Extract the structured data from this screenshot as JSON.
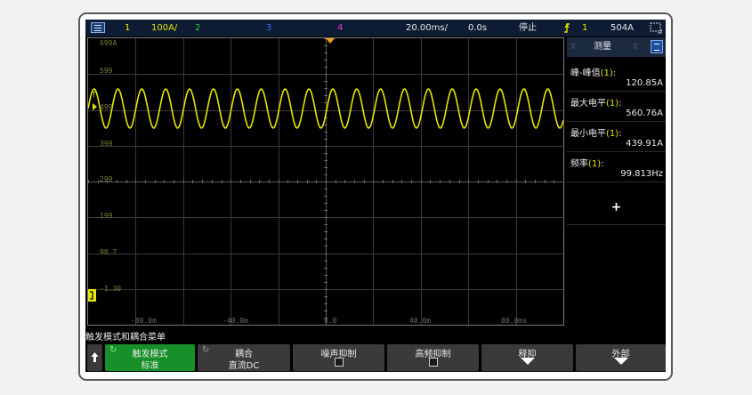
{
  "status_bar": {
    "ch1_num": "1",
    "ch1_scale": "100A/",
    "ch2_num": "2",
    "ch3_num": "3",
    "ch4_num": "4",
    "time_scale": "20.00ms/",
    "delay": "0.0s",
    "run_state": "停止",
    "trig_src": "1",
    "trig_level": "504A"
  },
  "waveform": {
    "y_labels": [
      "699A",
      "599",
      "499",
      "399",
      "299",
      "199",
      "98.7",
      "-1.30"
    ],
    "x_labels": [
      "-80.0m",
      "-40.0m",
      "0.0",
      "40.0m",
      "80.0ms"
    ],
    "trig_marker": "T"
  },
  "measure_panel": {
    "title": "测量",
    "items": [
      {
        "label": "峰-峰值",
        "ch": "(1)",
        "suffix": ":",
        "value": "120.85A"
      },
      {
        "label": "最大电平",
        "ch": "(1)",
        "suffix": ":",
        "value": "560.76A"
      },
      {
        "label": "最小电平",
        "ch": "(1)",
        "suffix": ":",
        "value": "439.91A"
      },
      {
        "label": "频率",
        "ch": "(1)",
        "suffix": ":",
        "value": "99.813Hz"
      }
    ],
    "add_label": "+"
  },
  "softkeys": {
    "menu_title": "触发模式和耦合菜单",
    "keys": [
      {
        "l1": "触发模式",
        "l2": "标准"
      },
      {
        "l1": "耦合",
        "l2": "直流DC"
      },
      {
        "l1": "噪声抑制",
        "l2": ""
      },
      {
        "l1": "高频抑制",
        "l2": ""
      },
      {
        "l1": "释抑",
        "l2": ""
      },
      {
        "l1": "外部",
        "l2": ""
      }
    ]
  }
}
